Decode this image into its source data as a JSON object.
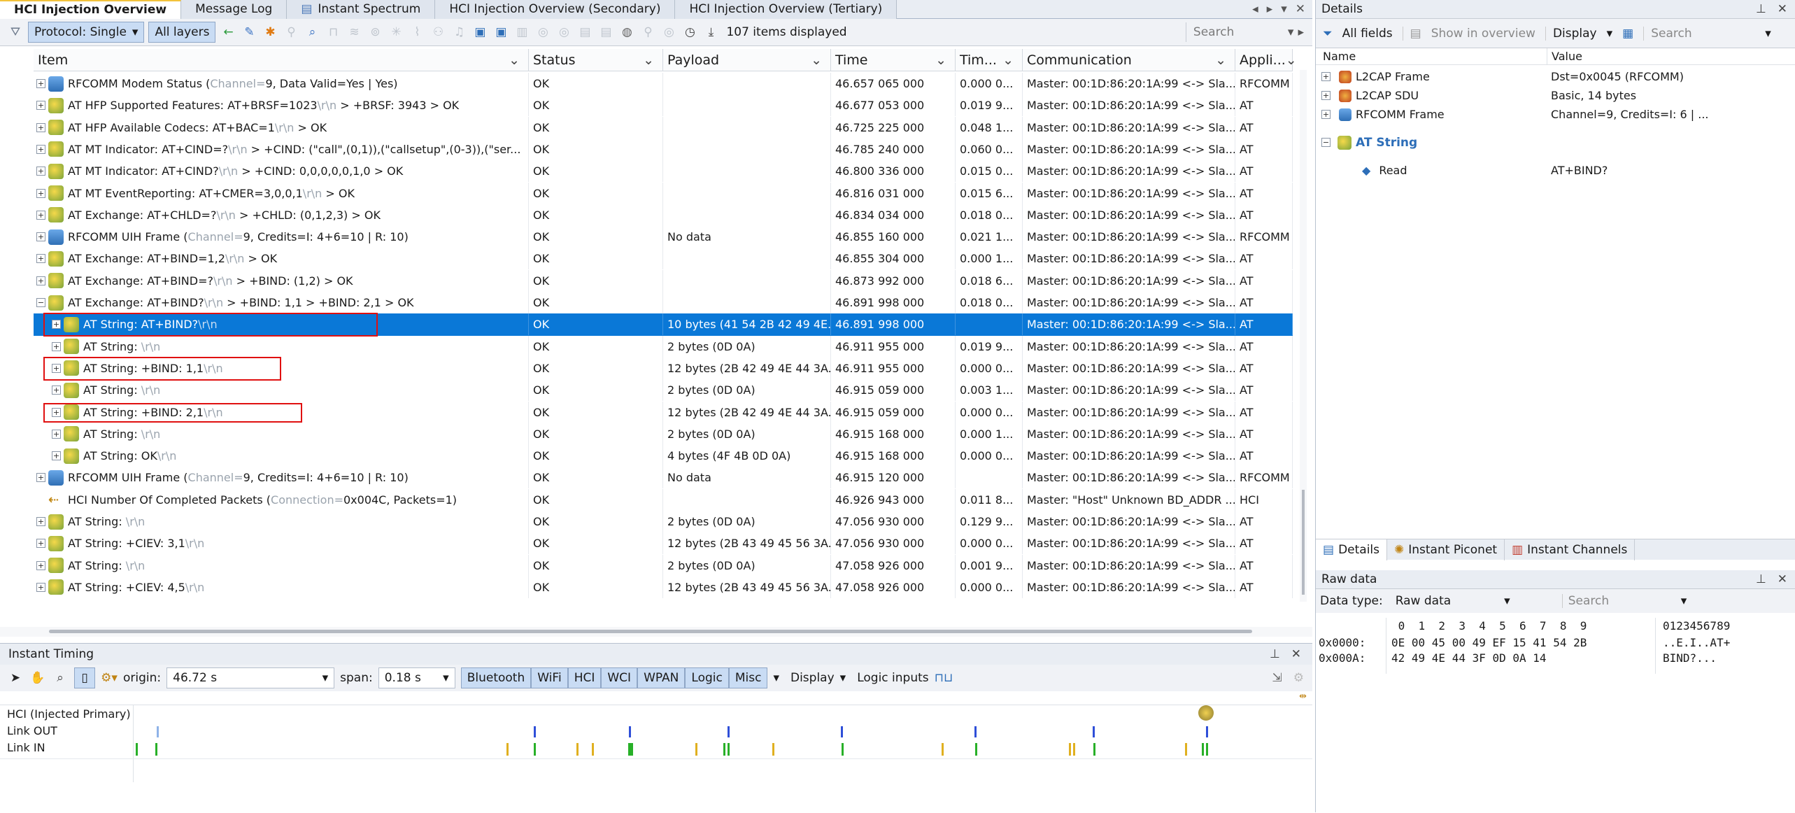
{
  "tabs": [
    {
      "label": "HCI Injection Overview"
    },
    {
      "label": "Message Log"
    },
    {
      "label": "Instant Spectrum"
    },
    {
      "label": "HCI Injection Overview (Secondary)"
    },
    {
      "label": "HCI Injection Overview (Tertiary)"
    }
  ],
  "toolbar": {
    "protocol_label": "Protocol: Single",
    "layers_label": "All layers",
    "items_displayed": "107 items displayed",
    "search_placeholder": "Search"
  },
  "columns": [
    "Item",
    "Status",
    "Payload",
    "Time",
    "Tim...",
    "Communication",
    "Appli..."
  ],
  "rows": [
    {
      "indent": 0,
      "icon": "rfcomm",
      "item": "RFCOMM Modem Status (",
      "item_dim": "Channel=",
      "item_rest": "9, Data Valid=Yes | Yes)",
      "status": "OK",
      "payload": "",
      "time": "46.657 065 000",
      "delta": "0.000 0...",
      "comm": "Master: 00:1D:86:20:1A:99 <-> Sla...",
      "app": "RFCOMM"
    },
    {
      "indent": 0,
      "icon": "at",
      "item": "AT HFP Supported Features: AT+BRSF=1023",
      "item_dim": "\\r\\n",
      "item_rest": " > +BRSF: 3943 > OK",
      "status": "OK",
      "payload": "",
      "time": "46.677 053 000",
      "delta": "0.019 9...",
      "comm": "Master: 00:1D:86:20:1A:99 <-> Sla...",
      "app": "AT"
    },
    {
      "indent": 0,
      "icon": "at",
      "item": "AT HFP Available Codecs: AT+BAC=1",
      "item_dim": "\\r\\n",
      "item_rest": " > OK",
      "status": "OK",
      "payload": "",
      "time": "46.725 225 000",
      "delta": "0.048 1...",
      "comm": "Master: 00:1D:86:20:1A:99 <-> Sla...",
      "app": "AT"
    },
    {
      "indent": 0,
      "icon": "at",
      "item": "AT MT Indicator: AT+CIND=?",
      "item_dim": "\\r\\n",
      "item_rest": " > +CIND: (\"call\",(0,1)),(\"callsetup\",(0-3)),(\"ser...",
      "status": "OK",
      "payload": "",
      "time": "46.785 240 000",
      "delta": "0.060 0...",
      "comm": "Master: 00:1D:86:20:1A:99 <-> Sla...",
      "app": "AT"
    },
    {
      "indent": 0,
      "icon": "at",
      "item": "AT MT Indicator: AT+CIND?",
      "item_dim": "\\r\\n",
      "item_rest": " > +CIND: 0,0,0,0,0,1,0 > OK",
      "status": "OK",
      "payload": "",
      "time": "46.800 336 000",
      "delta": "0.015 0...",
      "comm": "Master: 00:1D:86:20:1A:99 <-> Sla...",
      "app": "AT"
    },
    {
      "indent": 0,
      "icon": "at",
      "item": "AT MT EventReporting: AT+CMER=3,0,0,1",
      "item_dim": "\\r\\n",
      "item_rest": " > OK",
      "status": "OK",
      "payload": "",
      "time": "46.816 031 000",
      "delta": "0.015 6...",
      "comm": "Master: 00:1D:86:20:1A:99 <-> Sla...",
      "app": "AT"
    },
    {
      "indent": 0,
      "icon": "at",
      "item": "AT Exchange: AT+CHLD=?",
      "item_dim": "\\r\\n",
      "item_rest": " > +CHLD: (0,1,2,3) > OK",
      "status": "OK",
      "payload": "",
      "time": "46.834 034 000",
      "delta": "0.018 0...",
      "comm": "Master: 00:1D:86:20:1A:99 <-> Sla...",
      "app": "AT"
    },
    {
      "indent": 0,
      "icon": "rfcomm",
      "item": "RFCOMM UIH Frame (",
      "item_dim": "Channel=",
      "item_rest": "9, Credits=I: 4+6=10 | R: 10)",
      "status": "OK",
      "payload": "No data",
      "time": "46.855 160 000",
      "delta": "0.021 1...",
      "comm": "Master: 00:1D:86:20:1A:99 <-> Sla...",
      "app": "RFCOMM"
    },
    {
      "indent": 0,
      "icon": "at",
      "item": "AT Exchange: AT+BIND=1,2",
      "item_dim": "\\r\\n",
      "item_rest": " > OK",
      "status": "OK",
      "payload": "",
      "time": "46.855 304 000",
      "delta": "0.000 1...",
      "comm": "Master: 00:1D:86:20:1A:99 <-> Sla...",
      "app": "AT"
    },
    {
      "indent": 0,
      "icon": "at",
      "item": "AT Exchange: AT+BIND=?",
      "item_dim": "\\r\\n",
      "item_rest": " > +BIND: (1,2) > OK",
      "status": "OK",
      "payload": "",
      "time": "46.873 992 000",
      "delta": "0.018 6...",
      "comm": "Master: 00:1D:86:20:1A:99 <-> Sla...",
      "app": "AT"
    },
    {
      "indent": 0,
      "icon": "at",
      "expanded": true,
      "item": "AT Exchange: AT+BIND?",
      "item_dim": "\\r\\n",
      "item_rest": " > +BIND: 1,1 > +BIND: 2,1 > OK",
      "status": "OK",
      "payload": "",
      "time": "46.891 998 000",
      "delta": "0.018 0...",
      "comm": "Master: 00:1D:86:20:1A:99 <-> Sla...",
      "app": "AT"
    },
    {
      "indent": 1,
      "icon": "at",
      "selected": true,
      "item": "AT String: AT+BIND?",
      "item_dim": "\\r\\n",
      "item_rest": "",
      "status": "OK",
      "payload": "10 bytes (41 54 2B 42 49 4E...",
      "time": "46.891 998 000",
      "delta": "",
      "comm": "Master: 00:1D:86:20:1A:99 <-> Sla...",
      "app": "AT"
    },
    {
      "indent": 1,
      "icon": "at",
      "item": "AT String: ",
      "item_dim": "\\r\\n",
      "item_rest": "",
      "status": "OK",
      "payload": "2 bytes (0D 0A)",
      "time": "46.911 955 000",
      "delta": "0.019 9...",
      "comm": "Master: 00:1D:86:20:1A:99 <-> Sla...",
      "app": "AT"
    },
    {
      "indent": 1,
      "icon": "at",
      "item": "AT String: +BIND: 1,1",
      "item_dim": "\\r\\n",
      "item_rest": "",
      "status": "OK",
      "payload": "12 bytes (2B 42 49 4E 44 3A...",
      "time": "46.911 955 000",
      "delta": "0.000 0...",
      "comm": "Master: 00:1D:86:20:1A:99 <-> Sla...",
      "app": "AT"
    },
    {
      "indent": 1,
      "icon": "at",
      "item": "AT String: ",
      "item_dim": "\\r\\n",
      "item_rest": "",
      "status": "OK",
      "payload": "2 bytes (0D 0A)",
      "time": "46.915 059 000",
      "delta": "0.003 1...",
      "comm": "Master: 00:1D:86:20:1A:99 <-> Sla...",
      "app": "AT"
    },
    {
      "indent": 1,
      "icon": "at",
      "item": "AT String: +BIND: 2,1",
      "item_dim": "\\r\\n",
      "item_rest": "",
      "status": "OK",
      "payload": "12 bytes (2B 42 49 4E 44 3A...",
      "time": "46.915 059 000",
      "delta": "0.000 0...",
      "comm": "Master: 00:1D:86:20:1A:99 <-> Sla...",
      "app": "AT"
    },
    {
      "indent": 1,
      "icon": "at",
      "item": "AT String: ",
      "item_dim": "\\r\\n",
      "item_rest": "",
      "status": "OK",
      "payload": "2 bytes (0D 0A)",
      "time": "46.915 168 000",
      "delta": "0.000 1...",
      "comm": "Master: 00:1D:86:20:1A:99 <-> Sla...",
      "app": "AT"
    },
    {
      "indent": 1,
      "icon": "at",
      "item": "AT String: OK",
      "item_dim": "\\r\\n",
      "item_rest": "",
      "status": "OK",
      "payload": "4 bytes (4F 4B 0D 0A)",
      "time": "46.915 168 000",
      "delta": "0.000 0...",
      "comm": "Master: 00:1D:86:20:1A:99 <-> Sla...",
      "app": "AT"
    },
    {
      "indent": 0,
      "icon": "rfcomm",
      "item": "RFCOMM UIH Frame (",
      "item_dim": "Channel=",
      "item_rest": "9, Credits=I: 4+6=10 | R: 10)",
      "status": "OK",
      "payload": "No data",
      "time": "46.915 120 000",
      "delta": "",
      "comm": "Master: 00:1D:86:20:1A:99 <-> Sla...",
      "app": "RFCOMM"
    },
    {
      "indent": 0,
      "icon": "hci",
      "noexp": true,
      "item": "HCI Number Of Completed Packets (",
      "item_dim": "Connection=",
      "item_rest": "0x004C, Packets=1)",
      "status": "OK",
      "payload": "",
      "time": "46.926 943 000",
      "delta": "0.011 8...",
      "comm": "Master: \"Host\" Unknown BD_ADDR ...",
      "app": "HCI"
    },
    {
      "indent": 0,
      "icon": "at",
      "item": "AT String: ",
      "item_dim": "\\r\\n",
      "item_rest": "",
      "status": "OK",
      "payload": "2 bytes (0D 0A)",
      "time": "47.056 930 000",
      "delta": "0.129 9...",
      "comm": "Master: 00:1D:86:20:1A:99 <-> Sla...",
      "app": "AT"
    },
    {
      "indent": 0,
      "icon": "at",
      "item": "AT String: +CIEV: 3,1",
      "item_dim": "\\r\\n",
      "item_rest": "",
      "status": "OK",
      "payload": "12 bytes (2B 43 49 45 56 3A...",
      "time": "47.056 930 000",
      "delta": "0.000 0...",
      "comm": "Master: 00:1D:86:20:1A:99 <-> Sla...",
      "app": "AT"
    },
    {
      "indent": 0,
      "icon": "at",
      "item": "AT String: ",
      "item_dim": "\\r\\n",
      "item_rest": "",
      "status": "OK",
      "payload": "2 bytes (0D 0A)",
      "time": "47.058 926 000",
      "delta": "0.001 9...",
      "comm": "Master: 00:1D:86:20:1A:99 <-> Sla...",
      "app": "AT"
    },
    {
      "indent": 0,
      "icon": "at",
      "item": "AT String: +CIEV: 4,5",
      "item_dim": "\\r\\n",
      "item_rest": "",
      "status": "OK",
      "payload": "12 bytes (2B 43 49 45 56 3A...",
      "time": "47.058 926 000",
      "delta": "0.000 0...",
      "comm": "Master: 00:1D:86:20:1A:99 <-> Sla...",
      "app": "AT"
    }
  ],
  "timing": {
    "title": "Instant Timing",
    "origin_label": "origin:",
    "origin_value": "46.72 s",
    "span_label": "span:",
    "span_value": "0.18 s",
    "filters": [
      "Bluetooth",
      "WiFi",
      "HCI",
      "WCI",
      "WPAN",
      "Logic",
      "Misc"
    ],
    "display_label": "Display",
    "logic_inputs_label": "Logic inputs",
    "track_labels": [
      "HCI (Injected Primary)",
      "Link OUT",
      "Link IN"
    ]
  },
  "details": {
    "title": "Details",
    "all_fields": "All fields",
    "show_in_overview": "Show in overview",
    "display_label": "Display",
    "search_placeholder": "Search",
    "col_name": "Name",
    "col_value": "Value",
    "rows": [
      {
        "name": "L2CAP Frame",
        "value": "Dst=0x0045 (RFCOMM)"
      },
      {
        "name": "L2CAP SDU",
        "value": "Basic, 14 bytes"
      },
      {
        "name": "RFCOMM Frame",
        "value": "Channel=9, Credits=I: 6 | ..."
      }
    ],
    "section": "AT String",
    "sub_name": "Read",
    "sub_value": "AT+BIND?",
    "bottom_tabs": [
      "Details",
      "Instant Piconet",
      "Instant Channels"
    ]
  },
  "rawdata": {
    "title": "Raw data",
    "datatype_label": "Data type:",
    "datatype_value": "Raw data",
    "search_placeholder": "Search",
    "hex_header": " 0  1  2  3  4  5  6  7  8  9",
    "ascii_header": "0123456789",
    "lines": [
      {
        "offset": "0x0000:",
        "hex": "0E 00 45 00 49 EF 15 41 54 2B",
        "ascii": "..E.I..AT+"
      },
      {
        "offset": "0x000A:",
        "hex": "42 49 4E 44 3F 0D 0A 14",
        "ascii": "BIND?..."
      }
    ]
  }
}
